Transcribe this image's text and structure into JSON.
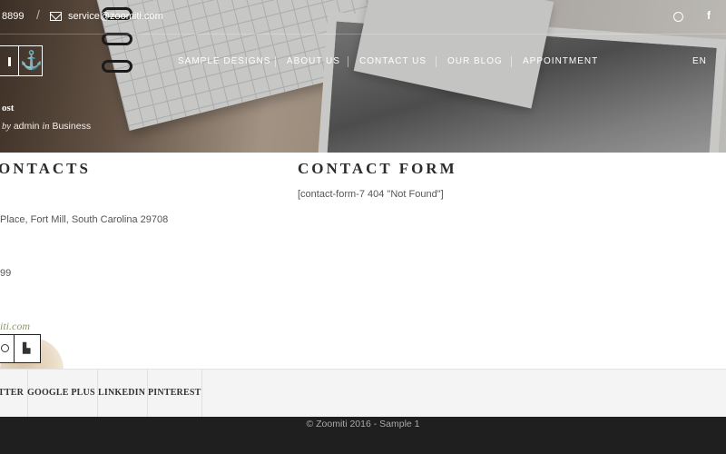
{
  "topbar": {
    "phone": "8899",
    "email": "service@zoomiti.com",
    "lang": "EN"
  },
  "nav": {
    "items": [
      "SAMPLE DESIGNS",
      "ABOUT US",
      "CONTACT US",
      "OUR BLOG",
      "APPOINTMENT"
    ]
  },
  "post": {
    "title": "ost",
    "by_label": "by",
    "author": "admin",
    "in_label": "in",
    "category": "Business"
  },
  "contacts": {
    "heading": "ONTACTS",
    "address": "Place, Fort Mill, South Carolina 29708",
    "phone": "99",
    "website": "iti.com"
  },
  "contact_form": {
    "heading": "CONTACT FORM",
    "shortcode": "[contact-form-7 404 \"Not Found\"]"
  },
  "footer_links": [
    "TTER",
    "GOOGLE PLUS",
    "LINKEDIN",
    "PINTEREST"
  ],
  "footer": {
    "copyright": "© Zoomiti 2016 - Sample 1"
  },
  "icons": {
    "mail": "mail-icon",
    "dribbble": "dribbble-icon",
    "facebook": "facebook-icon",
    "anchor": "anchor-icon",
    "evernote": "evernote-icon"
  }
}
